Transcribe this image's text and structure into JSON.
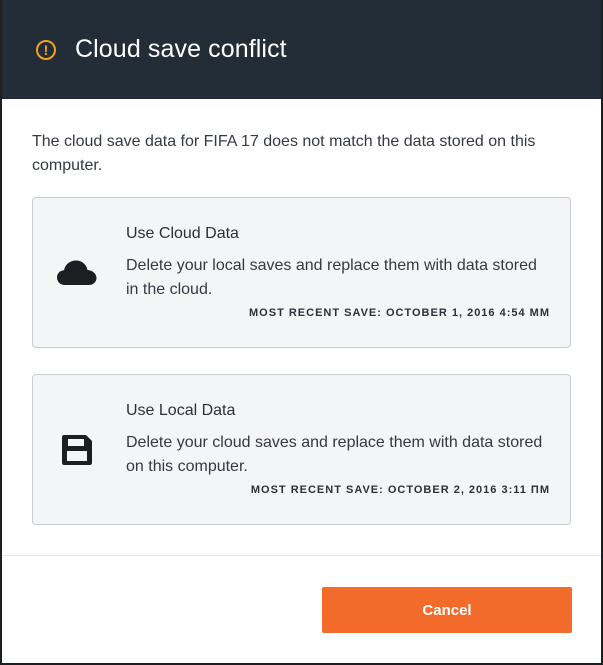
{
  "dialog": {
    "title": "Cloud save conflict",
    "title_icon": "warning-icon",
    "message": "The cloud save data for FIFA 17 does not match the data stored on this computer."
  },
  "options": [
    {
      "icon": "cloud-icon",
      "title": "Use Cloud Data",
      "description": "Delete your local saves and replace them with data stored in the cloud.",
      "recent": "MOST RECENT SAVE: OCTOBER 1, 2016 4:54 MM"
    },
    {
      "icon": "floppy-disk-icon",
      "title": "Use Local Data",
      "description": "Delete your cloud saves and replace them with data stored on this computer.",
      "recent": "MOST RECENT SAVE: OCTOBER 2, 2016 3:11 ПМ"
    }
  ],
  "footer": {
    "cancel_label": "Cancel"
  },
  "colors": {
    "header_bg": "#222d38",
    "accent": "#f26b2a",
    "warning": "#f0a31b",
    "card_bg": "#f4f5f7"
  }
}
